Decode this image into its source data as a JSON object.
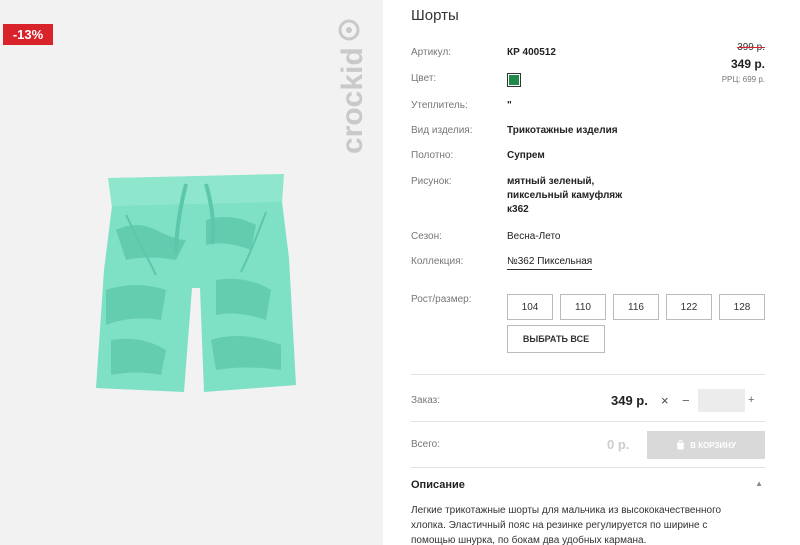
{
  "product": {
    "discount": "-13%",
    "brand": "crockid",
    "title": "Шорты"
  },
  "attributes": {
    "article_label": "Артикул:",
    "article_value": "КР 400512",
    "color_label": "Цвет:",
    "color_hex": "#1f8a4c",
    "insulation_label": "Утеплитель:",
    "insulation_value": "\"",
    "type_label": "Вид изделия:",
    "type_value": "Трикотажные изделия",
    "fabric_label": "Полотно:",
    "fabric_value": "Супрем",
    "pattern_label": "Рисунок:",
    "pattern_line1": "мятный зеленый,",
    "pattern_line2": "пиксельный камуфляж",
    "pattern_line3": "к362",
    "season_label": "Сезон:",
    "season_value": "Весна-Лето",
    "collection_label": "Коллекция:",
    "collection_value": "№362 Пиксельная"
  },
  "pricing": {
    "old_price": "399 р.",
    "new_price": "349 р.",
    "rrp": "РРЦ: 699 р."
  },
  "sizes": {
    "label": "Рост/размер:",
    "options": [
      "104",
      "110",
      "116",
      "122",
      "128"
    ],
    "select_all": "ВЫБРАТЬ ВСЕ"
  },
  "order": {
    "label": "Заказ:",
    "price": "349 р.",
    "times": "×",
    "minus": "−",
    "plus": "+",
    "quantity": ""
  },
  "total": {
    "label": "Всего:",
    "value": "0 р.",
    "cart_button": "В КОРЗИНУ"
  },
  "description": {
    "title": "Описание",
    "line1": "Легкие трикотажные шорты для мальчика из высококачественного",
    "line2": "хлопка. Эластичный пояс на резинке регулируется по ширине с",
    "line3": "помощью шнурка, по бокам два удобных кармана."
  },
  "colors": {
    "discount_bg": "#d8232a",
    "shorts_mint": "#7ee0c4",
    "camo_dark": "#5cc7aa"
  }
}
